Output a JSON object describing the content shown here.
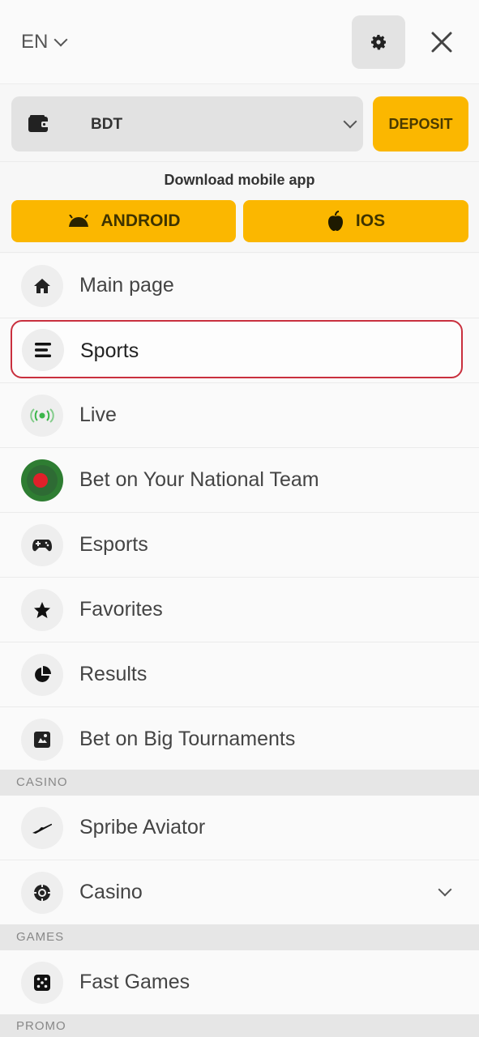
{
  "header": {
    "language": "EN"
  },
  "wallet": {
    "currency": "BDT",
    "deposit_label": "DEPOSIT"
  },
  "app": {
    "title": "Download mobile app",
    "android_label": "ANDROID",
    "ios_label": "IOS"
  },
  "menu": {
    "main_page": "Main page",
    "sports": "Sports",
    "live": "Live",
    "national_team": "Bet on Your National Team",
    "esports": "Esports",
    "favorites": "Favorites",
    "results": "Results",
    "big_tournaments": "Bet on Big Tournaments"
  },
  "sections": {
    "casino": "CASINO",
    "games": "GAMES",
    "promo": "PROMO"
  },
  "casino_menu": {
    "aviator": "Spribe Aviator",
    "casino": "Casino"
  },
  "games_menu": {
    "fast_games": "Fast Games"
  },
  "colors": {
    "accent_yellow": "#fbb700",
    "highlight_red": "#c9303e",
    "live_green": "#3cb64a",
    "flag_green": "#2e7d32",
    "flag_red": "#e0202a"
  },
  "icons": {
    "home": "home-icon",
    "sports": "hamburger-menu-icon",
    "live": "live-broadcast-icon",
    "national_team": "bangladesh-flag-icon",
    "esports": "gamepad-icon",
    "favorites": "star-icon",
    "results": "pie-chart-icon",
    "big_tournaments": "trophy-card-icon",
    "aviator": "airplane-icon",
    "casino": "roulette-chip-icon",
    "fast_games": "dice-icon"
  }
}
